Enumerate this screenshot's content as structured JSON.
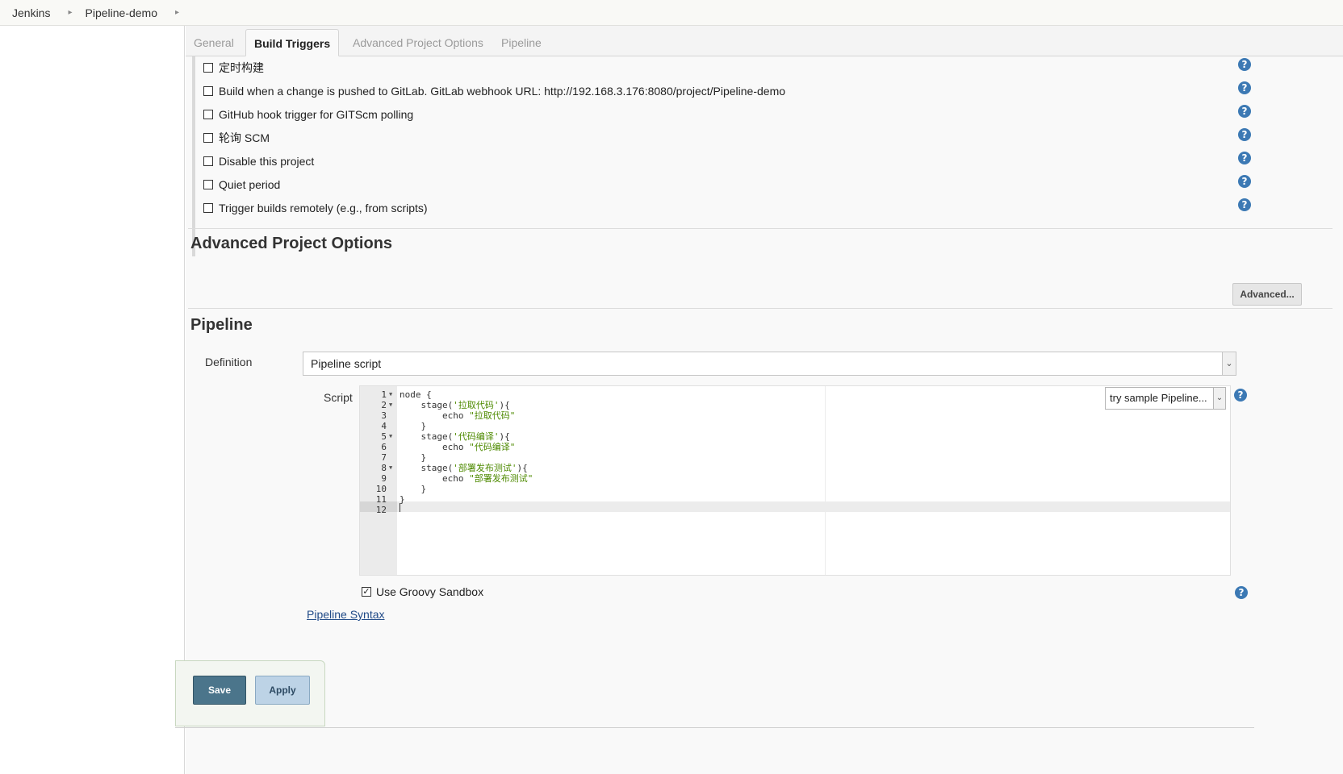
{
  "breadcrumb": {
    "root": "Jenkins",
    "job": "Pipeline-demo"
  },
  "tabs": [
    {
      "label": "General",
      "active": false
    },
    {
      "label": "Build Triggers",
      "active": true
    },
    {
      "label": "Advanced Project Options",
      "active": false
    },
    {
      "label": "Pipeline",
      "active": false
    }
  ],
  "triggers": [
    {
      "label": "定时构建",
      "checked": false
    },
    {
      "label": "Build when a change is pushed to GitLab. GitLab webhook URL: http://192.168.3.176:8080/project/Pipeline-demo",
      "checked": false
    },
    {
      "label": "GitHub hook trigger for GITScm polling",
      "checked": false
    },
    {
      "label": "轮询 SCM",
      "checked": false
    },
    {
      "label": "Disable this project",
      "checked": false
    },
    {
      "label": "Quiet period",
      "checked": false
    },
    {
      "label": "Trigger builds remotely (e.g., from scripts)",
      "checked": false
    }
  ],
  "help_icon": "?",
  "advanced_section": {
    "title": "Advanced Project Options",
    "button": "Advanced..."
  },
  "pipeline_section": {
    "title": "Pipeline",
    "definition_label": "Definition",
    "definition_value": "Pipeline script",
    "script_label": "Script",
    "sample_select": "try sample Pipeline...",
    "code_lines": [
      {
        "num": "1",
        "fold": true,
        "pre": "node {",
        "str": "",
        "post": ""
      },
      {
        "num": "2",
        "fold": true,
        "pre": "    stage(",
        "str": "'拉取代码'",
        "post": "){"
      },
      {
        "num": "3",
        "fold": false,
        "pre": "        echo ",
        "str": "\"拉取代码\"",
        "post": ""
      },
      {
        "num": "4",
        "fold": false,
        "pre": "    }",
        "str": "",
        "post": ""
      },
      {
        "num": "5",
        "fold": true,
        "pre": "    stage(",
        "str": "'代码编译'",
        "post": "){"
      },
      {
        "num": "6",
        "fold": false,
        "pre": "        echo ",
        "str": "\"代码编译\"",
        "post": ""
      },
      {
        "num": "7",
        "fold": false,
        "pre": "    }",
        "str": "",
        "post": ""
      },
      {
        "num": "8",
        "fold": true,
        "pre": "    stage(",
        "str": "'部署发布测试'",
        "post": "){"
      },
      {
        "num": "9",
        "fold": false,
        "pre": "        echo ",
        "str": "\"部署发布测试\"",
        "post": ""
      },
      {
        "num": "10",
        "fold": false,
        "pre": "    }",
        "str": "",
        "post": ""
      },
      {
        "num": "11",
        "fold": false,
        "pre": "}",
        "str": "",
        "post": ""
      },
      {
        "num": "12",
        "fold": false,
        "pre": "",
        "str": "",
        "post": ""
      }
    ],
    "sandbox_label": "Use Groovy Sandbox",
    "sandbox_checked": true,
    "syntax_link": "Pipeline Syntax"
  },
  "buttons": {
    "save": "Save",
    "apply": "Apply"
  },
  "colors": {
    "save_bg": "#4b758b",
    "apply_bg": "#bdd3e6",
    "help_icon": "#3c79b4",
    "string_literal": "#4e8a00"
  }
}
